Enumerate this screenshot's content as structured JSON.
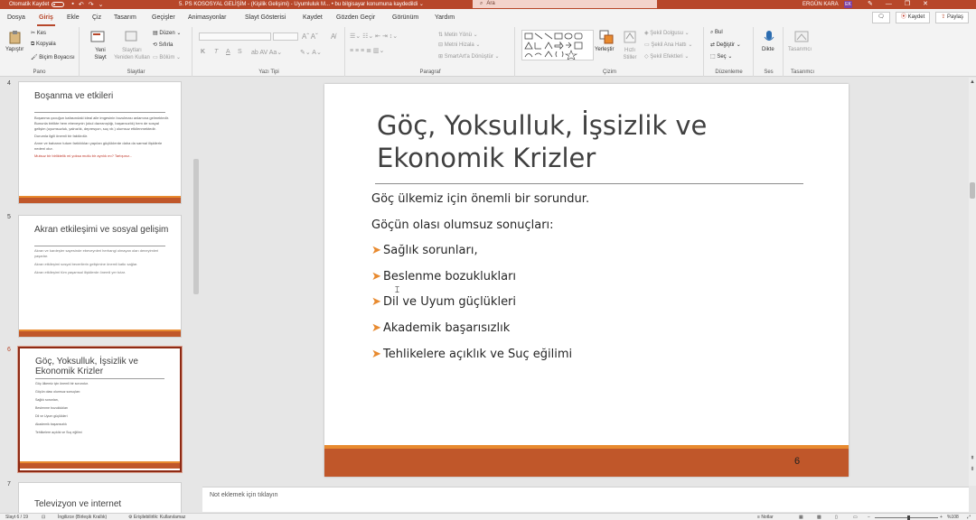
{
  "titlebar": {
    "autosave_label": "Otomatik Kaydet",
    "autosave_state": "Kapalı",
    "doc_title": "5. PS KOSOSYAL GELİŞİM - (Kişilik Gelişimi) - Uyumluluk M... • bu bilgisayar konumuna kaydedildi ⌄",
    "search_placeholder": "Ara",
    "user_name": "ERGÜN KARA",
    "user_initials": "EK",
    "colors": {
      "accent": "#b7472a",
      "bar": "#c0572a",
      "orange": "#e88a2f"
    }
  },
  "menu": {
    "tabs": [
      "Dosya",
      "Giriş",
      "Ekle",
      "Çiz",
      "Tasarım",
      "Geçişler",
      "Animasyonlar",
      "Slayt Gösterisi",
      "Kaydet",
      "Gözden Geçir",
      "Görünüm",
      "Yardım"
    ],
    "active_tab": "Giriş",
    "record_label": "Kaydet",
    "share_label": "Paylaş"
  },
  "ribbon": {
    "pano": {
      "paste": "Yapıştır",
      "cut": "Kes",
      "copy": "Kopyala",
      "format_painter": "Biçim Boyacısı",
      "label": "Pano"
    },
    "slaytlar": {
      "new_slide": "Yeni Slayt",
      "reuse": "Slaytları Yeniden Kullan",
      "layout": "Düzen",
      "reset": "Sıfırla",
      "section": "Bölüm",
      "label": "Slaytlar"
    },
    "yazitipi": {
      "bold": "K",
      "italic": "T",
      "underline": "A",
      "strike": "S",
      "label": "Yazı Tipi"
    },
    "paragraf": {
      "text_direction": "Metin Yönü",
      "align_text": "Metni Hizala",
      "smartart": "SmartArt'a Dönüştür",
      "label": "Paragraf"
    },
    "cizim": {
      "arrange": "Yerleştir",
      "quick_styles": "Hızlı Stiller",
      "fill": "Şekil Dolgusu",
      "outline": "Şekil Ana Hattı",
      "effects": "Şekil Efektleri",
      "label": "Çizim"
    },
    "duzenleme": {
      "find": "Bul",
      "replace": "Değiştir",
      "select": "Seç",
      "label": "Düzenleme"
    },
    "ses": {
      "dictate": "Dikte",
      "label": "Ses"
    },
    "tasarimci": {
      "designer": "Tasarımcı",
      "label": "Tasarımcı"
    }
  },
  "thumbnails": [
    {
      "num": "4",
      "title": "Boşanma ve etkileri",
      "lines": [
        "Boşanma çocuğun kafasındaki ideal aile imgesinin bozulması anlamına gelmektedir. Bununla birlikte hem ebeveynin (okul davranışlığı, başarısızlık) hem de sosyal gelişim (uyumsuzluk, yalnızlık, depresyon, suç vb.) olumsuz etkilenmektedir.",
        "Durumla ilgili önemli bir faktördür.",
        "Anne ve babanın tutum farklılıkları yapılan güçlüklerde daha da sarmal ilişkilerle nedeni olur."
      ],
      "red": "Mutsuz bir birliktelik mi yoksa mutlu bir ayrılık mı? Tartışınız..."
    },
    {
      "num": "5",
      "title": "Akran etkileşimi ve sosyal gelişim",
      "lines": [
        "Akran ve kardeşler sayesinde ebeveynleri herhangi olmayan olan deneyimleri yaşarlar.",
        "Akran etkileşimi sosyal becerilerin gelişimine önemli katkı sağlar.",
        "Akran etkileşimi tüm yaşamsal ilişkilerde önemli yer tutar."
      ],
      "red": ""
    },
    {
      "num": "6",
      "title": "Göç, Yoksulluk, İşsizlik ve Ekonomik Krizler",
      "lines": [
        "Göç ülkemiz için önemli bir sorundur.",
        "Göçün olası olumsuz sonuçları:",
        "Sağlık sorunları,",
        "Beslenme bozuklukları",
        "Dil ve Uyum güçlükleri",
        "Akademik başarısızlık",
        "Tehlikelere açıklık ve Suç eğilimi"
      ],
      "red": ""
    },
    {
      "num": "7",
      "title": "Televizyon ve internet",
      "lines": [],
      "red": ""
    }
  ],
  "slide": {
    "title": "Göç, Yoksulluk, İşsizlik ve Ekonomik Krizler",
    "paragraphs": [
      "Göç ülkemiz için önemli bir sorundur.",
      "Göçün olası olumsuz sonuçları:"
    ],
    "bullets": [
      "Sağlık sorunları,",
      "Beslenme bozuklukları",
      "Dil ve Uyum güçlükleri",
      "Akademik başarısızlık",
      "Tehlikelere açıklık ve Suç eğilimi"
    ],
    "bullet_glyph": "➤",
    "number": "6"
  },
  "notes_placeholder": "Not eklemek için tıklayın",
  "status": {
    "slide_counter": "Slayt 6 / 19",
    "language": "İngilizce (Birleşik Krallık)",
    "accessibility": "Erişilebilirlik: Kullanılamaz",
    "notes": "Notlar",
    "zoom": "%108"
  }
}
